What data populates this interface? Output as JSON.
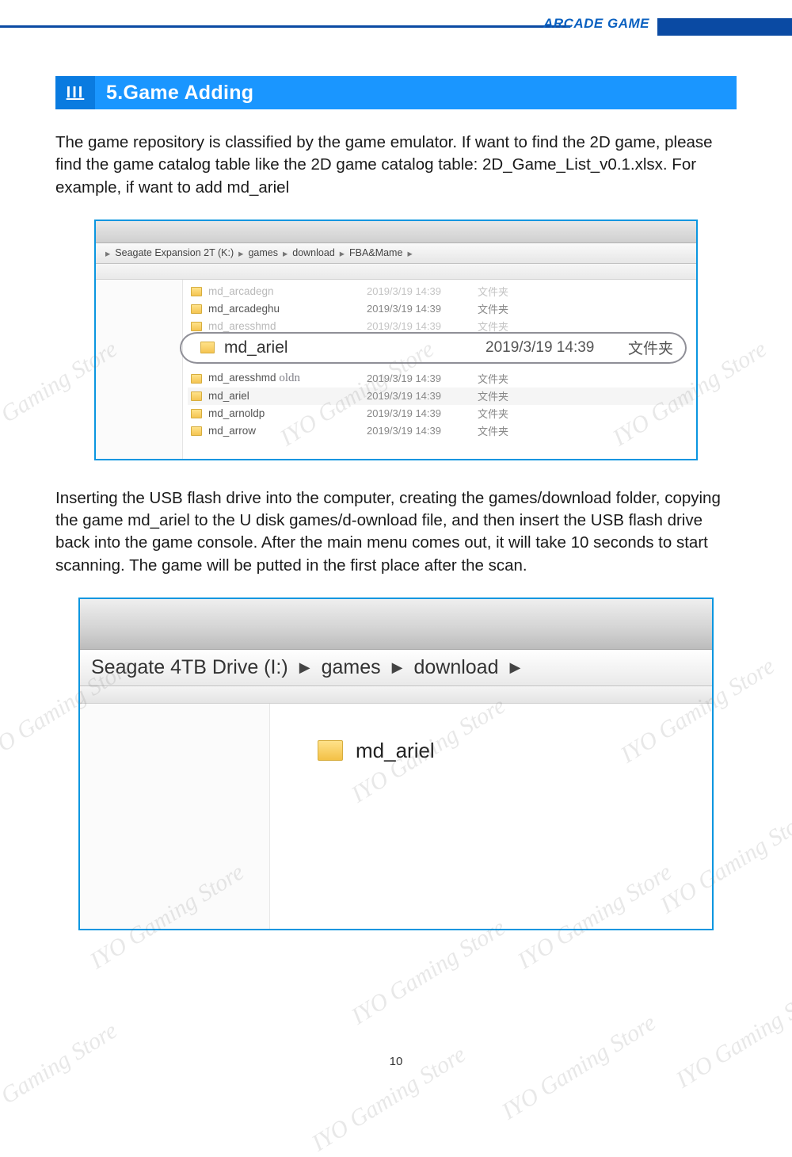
{
  "header": {
    "label": "ARCADE GAME"
  },
  "section": {
    "icon": "III",
    "title": "5.Game Adding"
  },
  "para1": "The game repository is classified by the game emulator.  If want to find the 2D game, please find the game catalog table like the 2D game catalog table: 2D_Game_List_v0.1.xlsx. For example, if want to add md_ariel",
  "shot1": {
    "breadcrumb": [
      "Seagate Expansion 2T (K:)",
      "games",
      "download",
      "FBA&Mame"
    ],
    "rows": [
      {
        "name": "md_arcadegn",
        "date": "2019/3/19 14:39",
        "type": "文件夹",
        "dim": true
      },
      {
        "name": "md_arcadeghu",
        "date": "2019/3/19 14:39",
        "type": "文件夹"
      },
      {
        "name": "md_aresshmd",
        "date": "2019/3/19 14:39",
        "type": "文件夹",
        "dim": true
      }
    ],
    "highlight": {
      "name": "md_ariel",
      "date": "2019/3/19 14:39",
      "type": "文件夹"
    },
    "scribble": "oldn",
    "rows2": [
      {
        "name": "md_aresshmd",
        "date": "2019/3/19 14:39",
        "type": "文件夹"
      },
      {
        "name": "md_ariel",
        "date": "2019/3/19 14:39",
        "type": "文件夹",
        "alt": true
      },
      {
        "name": "md_arnoldp",
        "date": "2019/3/19 14:39",
        "type": "文件夹"
      },
      {
        "name": "md_arrow",
        "date": "2019/3/19 14:39",
        "type": "文件夹"
      }
    ]
  },
  "para2": "Inserting the USB flash drive into the computer, creating the games/download folder, copying the game md_ariel to the U disk games/d-ownload file, and then insert the USB flash drive back into the game console. After the main menu comes out, it will take 10 seconds to start scanning. The game will be putted in the first place after the scan.",
  "shot2": {
    "breadcrumb": [
      "Seagate 4TB Drive (I:)",
      "games",
      "download"
    ],
    "folder": "md_ariel"
  },
  "watermark": "IYO Gaming Store",
  "page_number": "10"
}
